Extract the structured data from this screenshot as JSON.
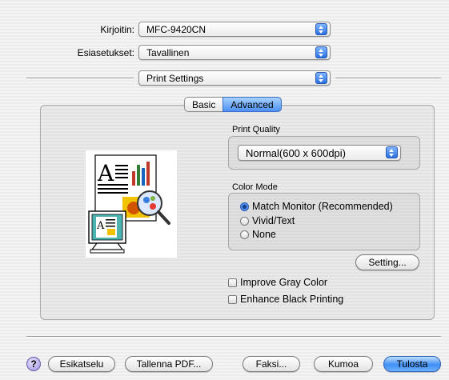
{
  "printer": {
    "label": "Kirjoitin:",
    "value": "MFC-9420CN"
  },
  "presets": {
    "label": "Esiasetukset:",
    "value": "Tavallinen"
  },
  "panel_select": {
    "value": "Print Settings"
  },
  "tabs": [
    {
      "label": "Basic",
      "active": false
    },
    {
      "label": "Advanced",
      "active": true
    }
  ],
  "print_quality": {
    "title": "Print Quality",
    "value": "Normal(600 x 600dpi)"
  },
  "color_mode": {
    "title": "Color Mode",
    "options": [
      {
        "label": "Match Monitor (Recommended)",
        "selected": true
      },
      {
        "label": "Vivid/Text",
        "selected": false
      },
      {
        "label": "None",
        "selected": false
      }
    ],
    "setting_button": "Setting..."
  },
  "checkboxes": [
    {
      "label": "Improve Gray Color",
      "checked": false
    },
    {
      "label": "Enhance Black Printing",
      "checked": false
    }
  ],
  "bottom": {
    "help": "?",
    "preview": "Esikatselu",
    "save_pdf": "Tallenna PDF...",
    "fax": "Faksi...",
    "cancel": "Kumoa",
    "print": "Tulosta"
  },
  "colors": {
    "accent": "#3f8ff5"
  },
  "illustration": {
    "icon": "printer-monitor-illustration"
  }
}
